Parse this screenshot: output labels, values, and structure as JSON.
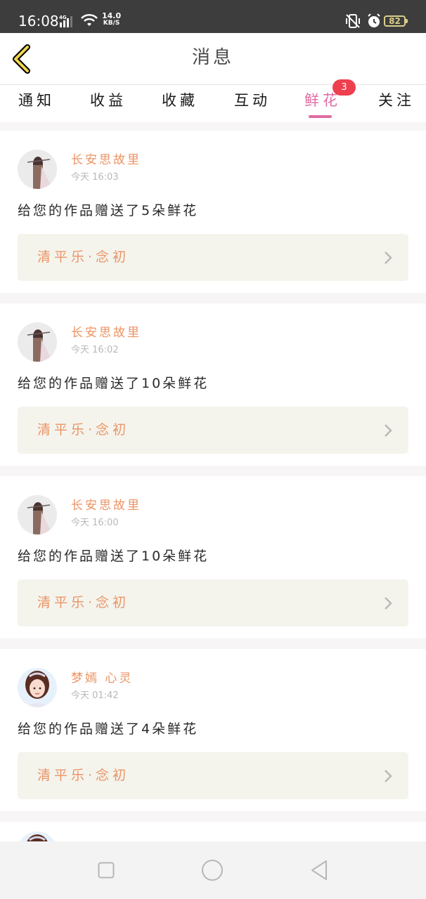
{
  "status_bar": {
    "time": "16:08",
    "network": "4G",
    "speed_value": "14.0",
    "speed_unit": "KB/S",
    "battery": "82",
    "icons": [
      "signal-icon",
      "wifi-icon",
      "silent-icon",
      "alarm-icon",
      "battery-icon"
    ]
  },
  "header": {
    "title": "消息",
    "back_icon": "chevron-left-icon"
  },
  "tabs": [
    {
      "label": "通知"
    },
    {
      "label": "收益"
    },
    {
      "label": "收藏"
    },
    {
      "label": "互动"
    },
    {
      "label": "鲜花",
      "active": true,
      "badge": "3"
    },
    {
      "label": "关注"
    }
  ],
  "feed": [
    {
      "user": "长安思故里",
      "time": "今天 16:03",
      "message": "给您的作品赠送了5朵鲜花",
      "work": "清平乐·念初"
    },
    {
      "user": "长安思故里",
      "time": "今天 16:02",
      "message": "给您的作品赠送了10朵鲜花",
      "work": "清平乐·念初"
    },
    {
      "user": "长安思故里",
      "time": "今天 16:00",
      "message": "给您的作品赠送了10朵鲜花",
      "work": "清平乐·念初"
    },
    {
      "user": "梦嫣 心灵",
      "time": "今天 01:42",
      "message": "给您的作品赠送了4朵鲜花",
      "work": "清平乐·念初"
    }
  ],
  "colors": {
    "accent_pink": "#e16ba2",
    "user_orange": "#ec9364",
    "badge_red": "#ee3f4e",
    "card_link_bg": "#f4f4ed",
    "status_bar_bg": "#3d3d3d"
  },
  "nav_bar": {
    "icons": [
      "recent-apps-icon",
      "home-icon",
      "back-icon"
    ]
  }
}
